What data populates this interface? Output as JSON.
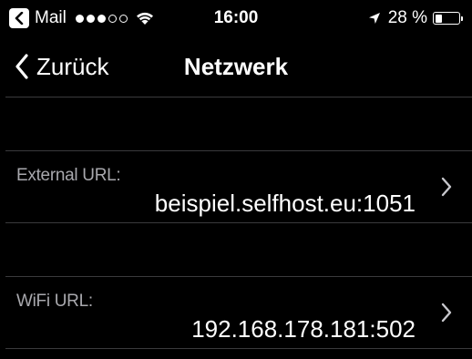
{
  "status_bar": {
    "back_app": "Mail",
    "signal_bars_filled": 3,
    "signal_bars_total": 5,
    "time": "16:00",
    "battery_percent": "28 %",
    "battery_level": 0.28,
    "icons": [
      "back-arrow-icon",
      "wifi-icon",
      "location-arrow-icon",
      "battery-icon"
    ]
  },
  "nav": {
    "back_label": "Zurück",
    "title": "Netzwerk"
  },
  "rows": [
    {
      "label": "External URL:",
      "value": "beispiel.selfhost.eu:1051"
    },
    {
      "label": "WiFi URL:",
      "value": "192.168.178.181:502"
    }
  ],
  "colors": {
    "background": "#000000",
    "text": "#ffffff",
    "secondary_text": "#a8a8ad",
    "separator": "#3a3a3c"
  }
}
